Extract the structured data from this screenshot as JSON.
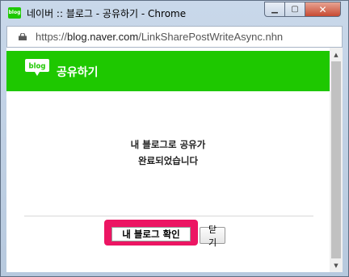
{
  "window": {
    "title": "네이버 :: 블로그 - 공유하기 - Chrome",
    "app_icon_text": "blog",
    "min_glyph": "▁",
    "max_glyph": "▢",
    "close_glyph": "✕"
  },
  "address": {
    "scheme": "https://",
    "host": "blog.naver.com",
    "path": "/LinkSharePostWriteAsync.nhn"
  },
  "header": {
    "logo_text": "blog",
    "title": "공유하기",
    "bg_color": "#1ec800"
  },
  "message": {
    "line1": "내 블로그로 공유가",
    "line2": "완료되었습니다"
  },
  "buttons": {
    "confirm_label": "내 블로그 확인",
    "close_label": "닫기",
    "highlight_color": "#ec1563"
  },
  "scrollbar": {
    "up_glyph": "▲",
    "down_glyph": "▼"
  }
}
